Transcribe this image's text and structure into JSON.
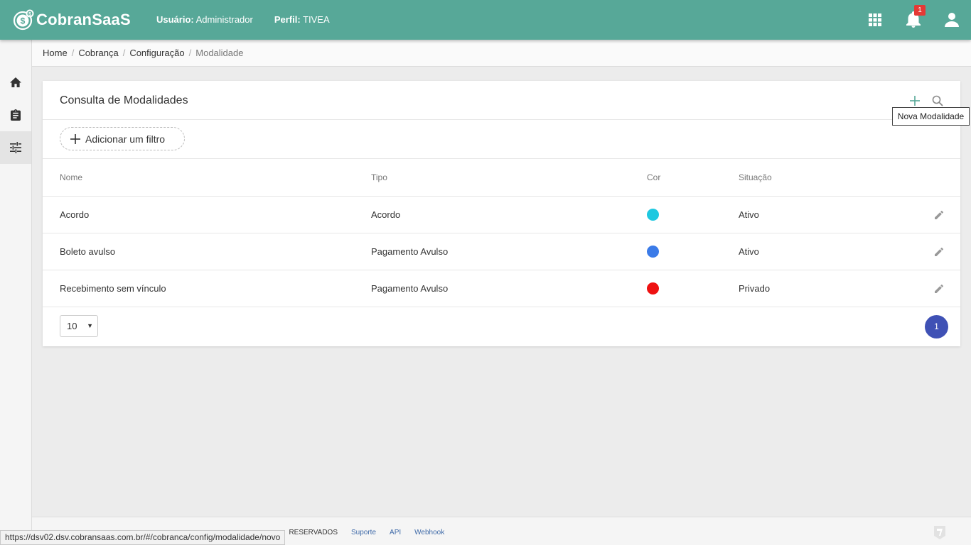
{
  "app": {
    "name": "CobranSaaS"
  },
  "header": {
    "user_label": "Usuário:",
    "user_value": "Administrador",
    "profile_label": "Perfil:",
    "profile_value": "TIVEA",
    "notifications_count": "1",
    "icons": [
      "apps-grid-icon",
      "bell-icon",
      "user-icon"
    ]
  },
  "sidebar": {
    "items": [
      "home-icon",
      "clipboard-icon",
      "settings-sliders-icon"
    ],
    "active_index": 2
  },
  "breadcrumb": {
    "items": [
      "Home",
      "Cobrança",
      "Configuração",
      "Modalidade"
    ]
  },
  "card": {
    "title": "Consulta de Modalidades",
    "add_filter_label": "Adicionar um filtro",
    "tooltip": "Nova Modalidade"
  },
  "table": {
    "columns": [
      "Nome",
      "Tipo",
      "Cor",
      "Situação"
    ],
    "rows": [
      {
        "nome": "Acordo",
        "tipo": "Acordo",
        "cor": "#1ec8e0",
        "situacao": "Ativo"
      },
      {
        "nome": "Boleto avulso",
        "tipo": "Pagamento Avulso",
        "cor": "#3b7be8",
        "situacao": "Ativo"
      },
      {
        "nome": "Recebimento sem vínculo",
        "tipo": "Pagamento Avulso",
        "cor": "#ee1111",
        "situacao": "Privado"
      }
    ]
  },
  "pagination": {
    "page_size": "10",
    "current_page": "1"
  },
  "footer": {
    "copyright": "S RESERVADOS.",
    "links": [
      "Suporte",
      "API",
      "Webhook"
    ]
  },
  "status_bar": {
    "url": "https://dsv02.dsv.cobransaas.com.br/#/cobranca/config/modalidade/novo"
  },
  "colors": {
    "primary": "#57a898",
    "pagination": "#3f51b5",
    "badge": "#e53935"
  }
}
